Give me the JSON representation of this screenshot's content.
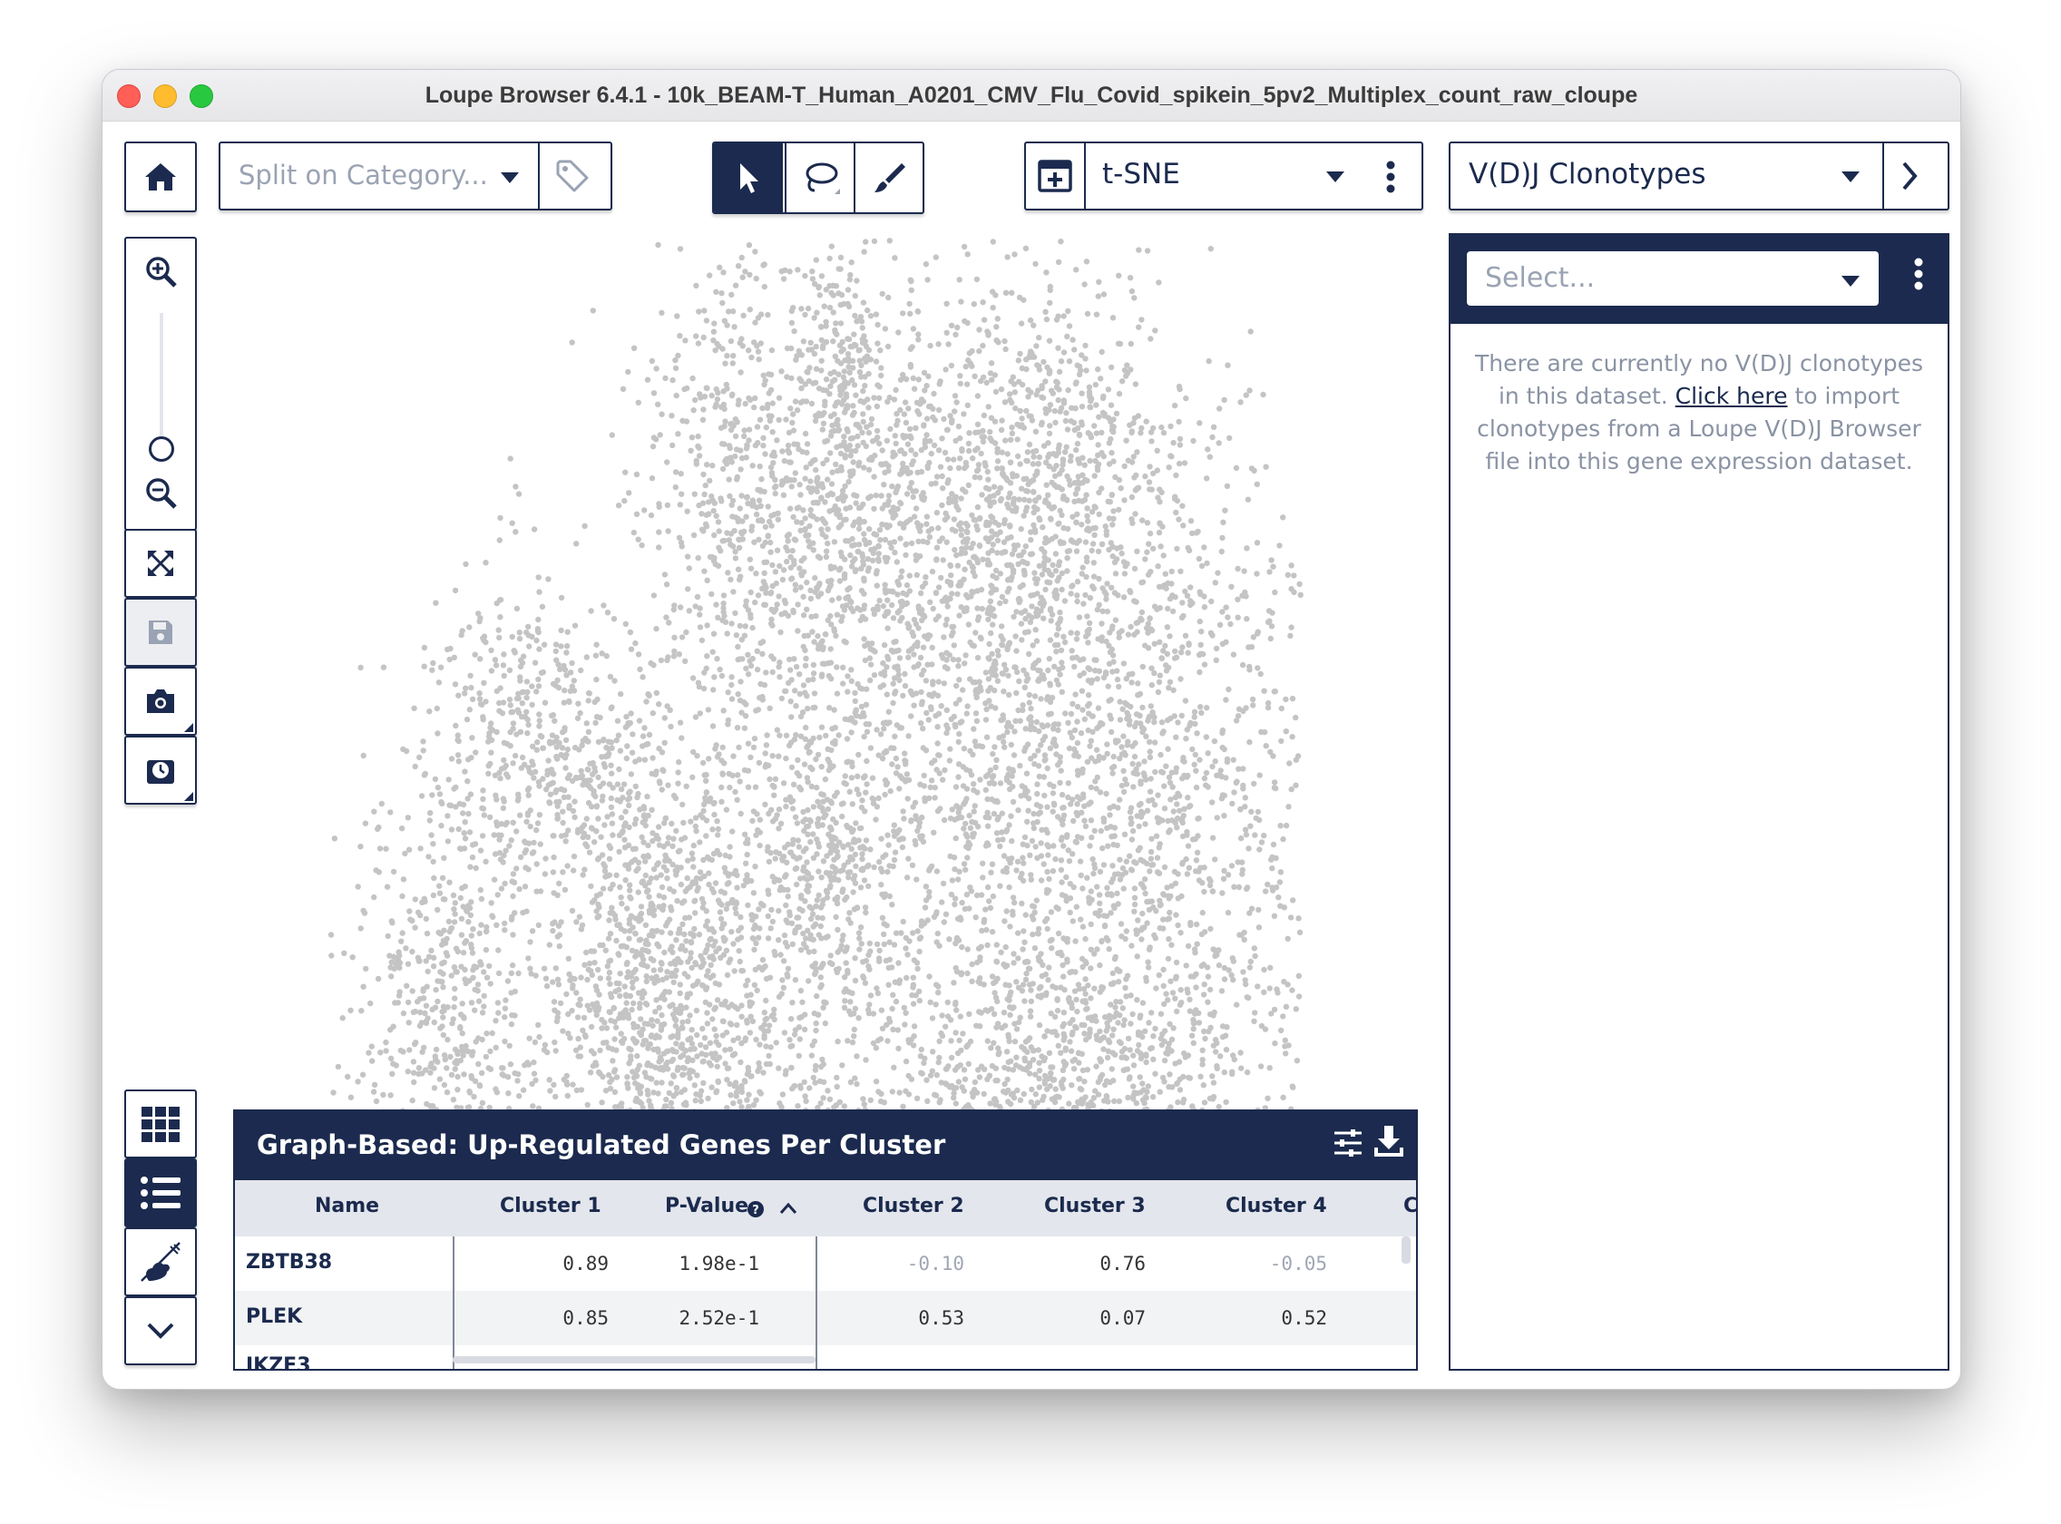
{
  "window": {
    "title": "Loupe Browser 6.4.1 - 10k_BEAM-T_Human_A0201_CMV_Flu_Covid_spikein_5pv2_Multiplex_count_raw_cloupe"
  },
  "toolbar": {
    "split_label": "Split on Category...",
    "projection_label": "t-SNE",
    "vdj_label": "V(D)J Clonotypes"
  },
  "table": {
    "title": "Graph-Based: Up-Regulated Genes Per Cluster",
    "columns": [
      "Name",
      "Cluster 1",
      "P-Value",
      "Cluster 2",
      "Cluster 3",
      "Cluster 4",
      "C"
    ],
    "rows": [
      {
        "name": "ZBTB38",
        "c1": "0.89",
        "p": "1.98e-1",
        "c2": "-0.10",
        "c3": "0.76",
        "c4": "-0.05"
      },
      {
        "name": "PLEK",
        "c1": "0.85",
        "p": "2.52e-1",
        "c2": "0.53",
        "c3": "0.07",
        "c4": "0.52"
      }
    ],
    "partial_row_name": "IKZF3"
  },
  "vdj_panel": {
    "select_placeholder": "Select...",
    "msg_part1": "There are currently no V(D)J clonotypes in this dataset. ",
    "msg_link": "Click here",
    "msg_part2": " to import clonotypes from a Loupe V(D)J Browser file into this gene expression dataset."
  },
  "colors": {
    "navy": "#1b2a4e",
    "point": "#c4c4c4",
    "muted_text": "#8a93a4"
  }
}
